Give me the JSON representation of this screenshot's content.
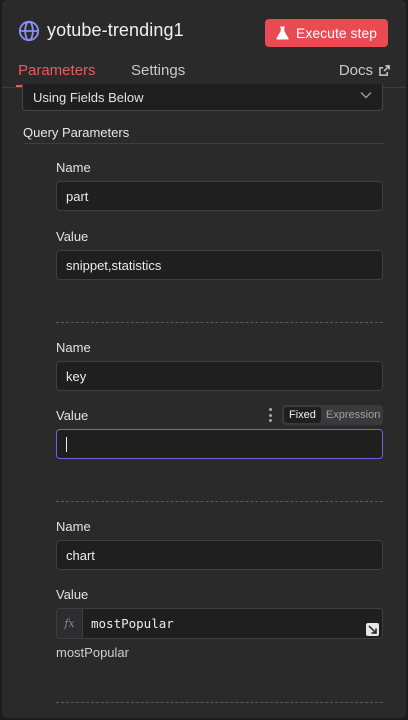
{
  "header": {
    "title": "yotube-trending1",
    "node_icon": "globe-icon",
    "execute_label": "Execute step",
    "execute_icon": "flask-icon",
    "accent_color": "#ea4b53"
  },
  "tabs": [
    {
      "label": "Parameters",
      "active": true
    },
    {
      "label": "Settings",
      "active": false
    },
    {
      "label": "Docs",
      "icon": "external-link-icon"
    }
  ],
  "specify_select": {
    "value": "Using Fields Below"
  },
  "query_section": {
    "title": "Query Parameters",
    "params": [
      {
        "name_label": "Name",
        "name_value": "part",
        "value_label": "Value",
        "value_value": "snippet,statistics"
      },
      {
        "name_label": "Name",
        "name_value": "key",
        "value_label": "Value",
        "value_value": "",
        "mode_fixed": "Fixed",
        "mode_expression": "Expression",
        "mode_selected": "Fixed"
      },
      {
        "name_label": "Name",
        "name_value": "chart",
        "value_label": "Value",
        "value_expression": "mostPopular",
        "expression_result": "mostPopular",
        "fx_label": "fx"
      }
    ]
  }
}
